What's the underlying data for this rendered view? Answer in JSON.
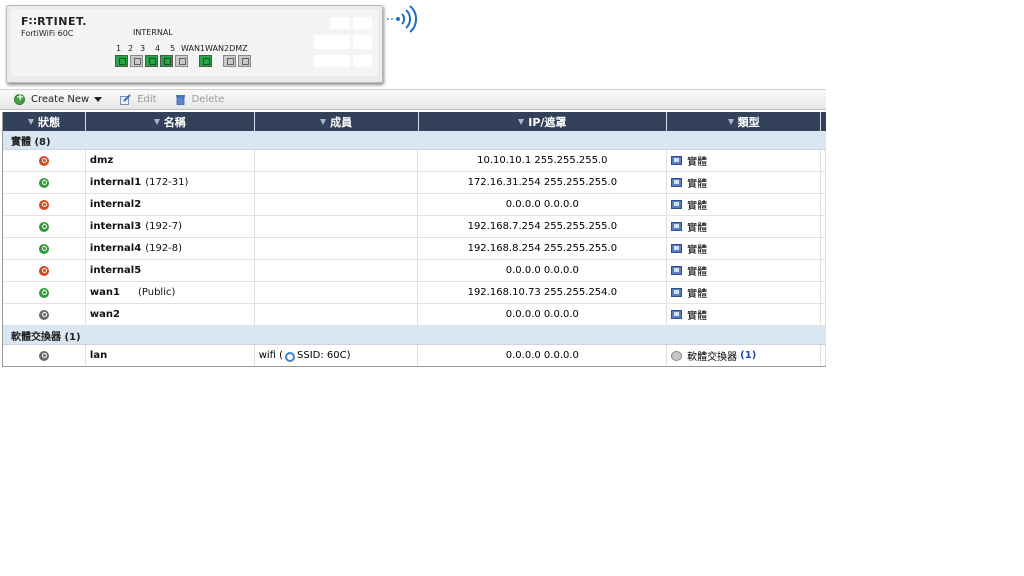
{
  "device": {
    "logo": "F∷RTINET.",
    "model": "FortiWiFi 60C",
    "port_group_label": "INTERNAL",
    "port_labels": [
      "1",
      "2",
      "3",
      "4",
      "5",
      "WAN1",
      "WAN2",
      "DMZ"
    ],
    "ports": [
      {
        "label": "1",
        "status": "up"
      },
      {
        "label": "2",
        "status": "down"
      },
      {
        "label": "3",
        "status": "up"
      },
      {
        "label": "4",
        "status": "up"
      },
      {
        "label": "5",
        "status": "down"
      },
      {
        "label": "WAN1",
        "status": "up"
      },
      {
        "label": "WAN2",
        "status": "down"
      },
      {
        "label": "DMZ",
        "status": "down"
      }
    ]
  },
  "toolbar": {
    "create_new": "Create New",
    "edit": "Edit",
    "delete": "Delete"
  },
  "table": {
    "headers": {
      "status": "狀態",
      "name": "名稱",
      "member": "成員",
      "ip": "IP/遮罩",
      "type": "類型"
    },
    "groups": [
      {
        "label": "實體 (8)",
        "rows": [
          {
            "status": "down",
            "name": "dmz",
            "alias": "",
            "member": "",
            "ip": "10.10.10.1 255.255.255.0",
            "type": "實體"
          },
          {
            "status": "up",
            "name": "internal1",
            "alias": "(172-31)",
            "member": "",
            "ip": "172.16.31.254 255.255.255.0",
            "type": "實體"
          },
          {
            "status": "down",
            "name": "internal2",
            "alias": "",
            "member": "",
            "ip": "0.0.0.0 0.0.0.0",
            "type": "實體"
          },
          {
            "status": "up",
            "name": "internal3",
            "alias": "(192-7)",
            "member": "",
            "ip": "192.168.7.254 255.255.255.0",
            "type": "實體"
          },
          {
            "status": "up",
            "name": "internal4",
            "alias": "(192-8)",
            "member": "",
            "ip": "192.168.8.254 255.255.255.0",
            "type": "實體"
          },
          {
            "status": "down",
            "name": "internal5",
            "alias": "",
            "member": "",
            "ip": "0.0.0.0 0.0.0.0",
            "type": "實體"
          },
          {
            "status": "up",
            "name": "wan1",
            "alias": "(Public)",
            "member": "",
            "ip": "192.168.10.73 255.255.254.0",
            "type": "實體"
          },
          {
            "status": "off",
            "name": "wan2",
            "alias": "",
            "member": "",
            "ip": "0.0.0.0 0.0.0.0",
            "type": "實體"
          }
        ]
      },
      {
        "label": "軟體交換器 (1)",
        "rows": [
          {
            "status": "off",
            "name": "lan",
            "alias": "",
            "member_prefix": "wifi (",
            "member_ssid": "SSID: 60C)",
            "ip": "0.0.0.0 0.0.0.0",
            "type": "軟體交換器",
            "type_count": "(1)"
          }
        ]
      }
    ]
  }
}
